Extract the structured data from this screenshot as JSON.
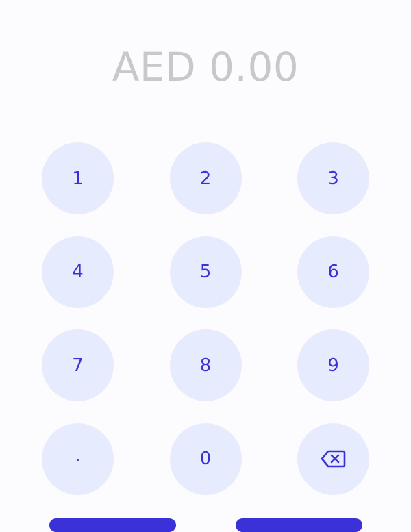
{
  "amount": {
    "display": "AED 0.00"
  },
  "keypad": {
    "keys": [
      {
        "label": "1"
      },
      {
        "label": "2"
      },
      {
        "label": "3"
      },
      {
        "label": "4"
      },
      {
        "label": "5"
      },
      {
        "label": "6"
      },
      {
        "label": "7"
      },
      {
        "label": "8"
      },
      {
        "label": "9"
      },
      {
        "label": "."
      },
      {
        "label": "0"
      },
      {
        "icon": "backspace-icon"
      }
    ]
  },
  "colors": {
    "accent": "#3a32d8",
    "key_background": "#e6ecfd",
    "amount_text": "#c8c8cc",
    "page_background": "#fcfcfe"
  }
}
